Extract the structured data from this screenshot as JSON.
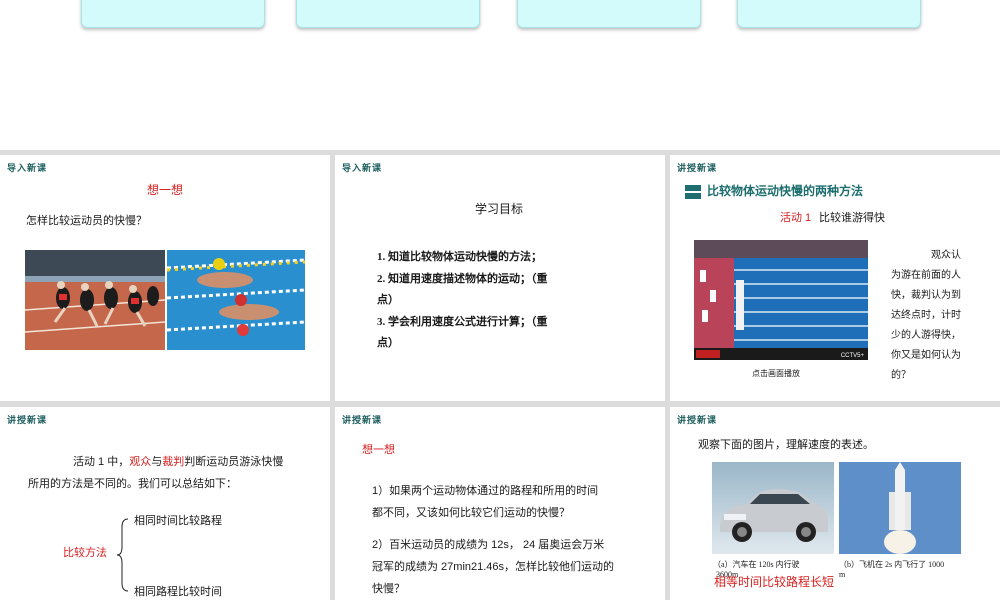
{
  "slides": {
    "s1": {
      "tag": "导入新课",
      "heading": "想一想",
      "question": "怎样比较运动员的快慢？"
    },
    "s2": {
      "tag": "导入新课",
      "title": "学习目标",
      "goals": [
        "1. 知道比较物体运动快慢的方法；",
        "2. 知道用速度描述物体的运动；（重",
        "点）",
        "3. 学会利用速度公式进行计算；（重",
        "点）"
      ]
    },
    "s3": {
      "tag": "讲授新课",
      "section_title": "比较物体运动快慢的两种方法",
      "activity_label": "活动 1",
      "activity_title": "比较谁游得快",
      "play_caption": "点击画面播放",
      "tv_text": "CCTV5+",
      "side_text": [
        "观众认",
        "为游在前面的人",
        "快，裁判认为到",
        "达终点时，计时",
        "少的人游得快，",
        "你又是如何认为",
        "的？"
      ]
    },
    "s4": {
      "tag": "讲授新课",
      "line1_a": "活动 1 中，",
      "line1_b": "观众",
      "line1_c": "与",
      "line1_d": "裁判",
      "line1_e": "判断运动员游泳快慢",
      "line2": "所用的方法是不同的。我们可以总结如下：",
      "method_label": "比较方法",
      "method_1": "相同时间比较路程",
      "method_2": "相同路程比较时间"
    },
    "s5": {
      "tag": "讲授新课",
      "heading": "想一想",
      "q1_a": "1）如果两个运动物体通过的路程和所用的时间",
      "q1_b": "都不同，又该如何比较它们运动的快慢？",
      "q2_a": "2）百米运动员的成绩为 12s， 24 届奥运会万米",
      "q2_b": "冠军的成绩为 27min21.46s，怎样比较他们运动的",
      "q2_c": "快慢？"
    },
    "s6": {
      "tag": "讲授新课",
      "intro": "观察下面的图片，理解速度的表述。",
      "cap_a_1": "（a）汽车在 120s 内行驶",
      "cap_a_2": "3600m",
      "cap_b_1": "（b）飞机在 2s 内飞行了 1000",
      "cap_b_2": "m",
      "conclusion": "相等时间比较路程长短"
    }
  },
  "colors": {
    "accent_red": "#d62020",
    "teal": "#1d6e6e",
    "card_bg": "#d4fbfb"
  }
}
